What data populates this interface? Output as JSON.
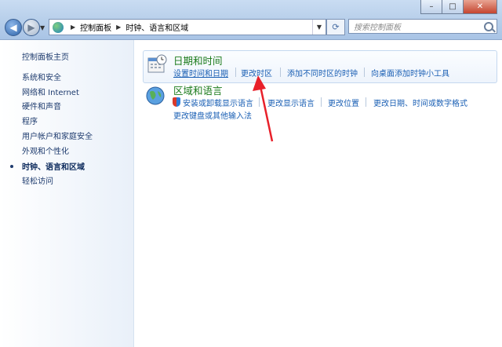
{
  "address": {
    "segments": [
      "控制面板",
      "时钟、语言和区域"
    ],
    "search_placeholder": "搜索控制面板"
  },
  "window_buttons": [
    "–",
    "□",
    "✕"
  ],
  "nav": {
    "back_icon": "back-arrow-icon",
    "forward_icon": "forward-arrow-icon",
    "back_glyph": "◀",
    "forward_glyph": "▶"
  },
  "sidebar": {
    "items": [
      {
        "label": "控制面板主页"
      },
      {
        "label": "系统和安全"
      },
      {
        "label": "网络和 Internet"
      },
      {
        "label": "硬件和声音"
      },
      {
        "label": "程序"
      },
      {
        "label": "用户帐户和家庭安全"
      },
      {
        "label": "外观和个性化"
      },
      {
        "label": "时钟、语言和区域",
        "active": true
      },
      {
        "label": "轻松访问"
      }
    ]
  },
  "categories": [
    {
      "title": "日期和时间",
      "links": [
        "设置时间和日期",
        "更改时区",
        "添加不同时区的时钟",
        "向桌面添加时钟小工具"
      ]
    },
    {
      "title": "区域和语言",
      "links": [
        "安装或卸载显示语言",
        "更改显示语言",
        "更改位置",
        "更改日期、时间或数字格式",
        "更改键盘或其他输入法"
      ]
    }
  ],
  "colors": {
    "accent_red": "#e8202a",
    "link": "#1a5fb4",
    "title_green": "#1a7a1a"
  }
}
